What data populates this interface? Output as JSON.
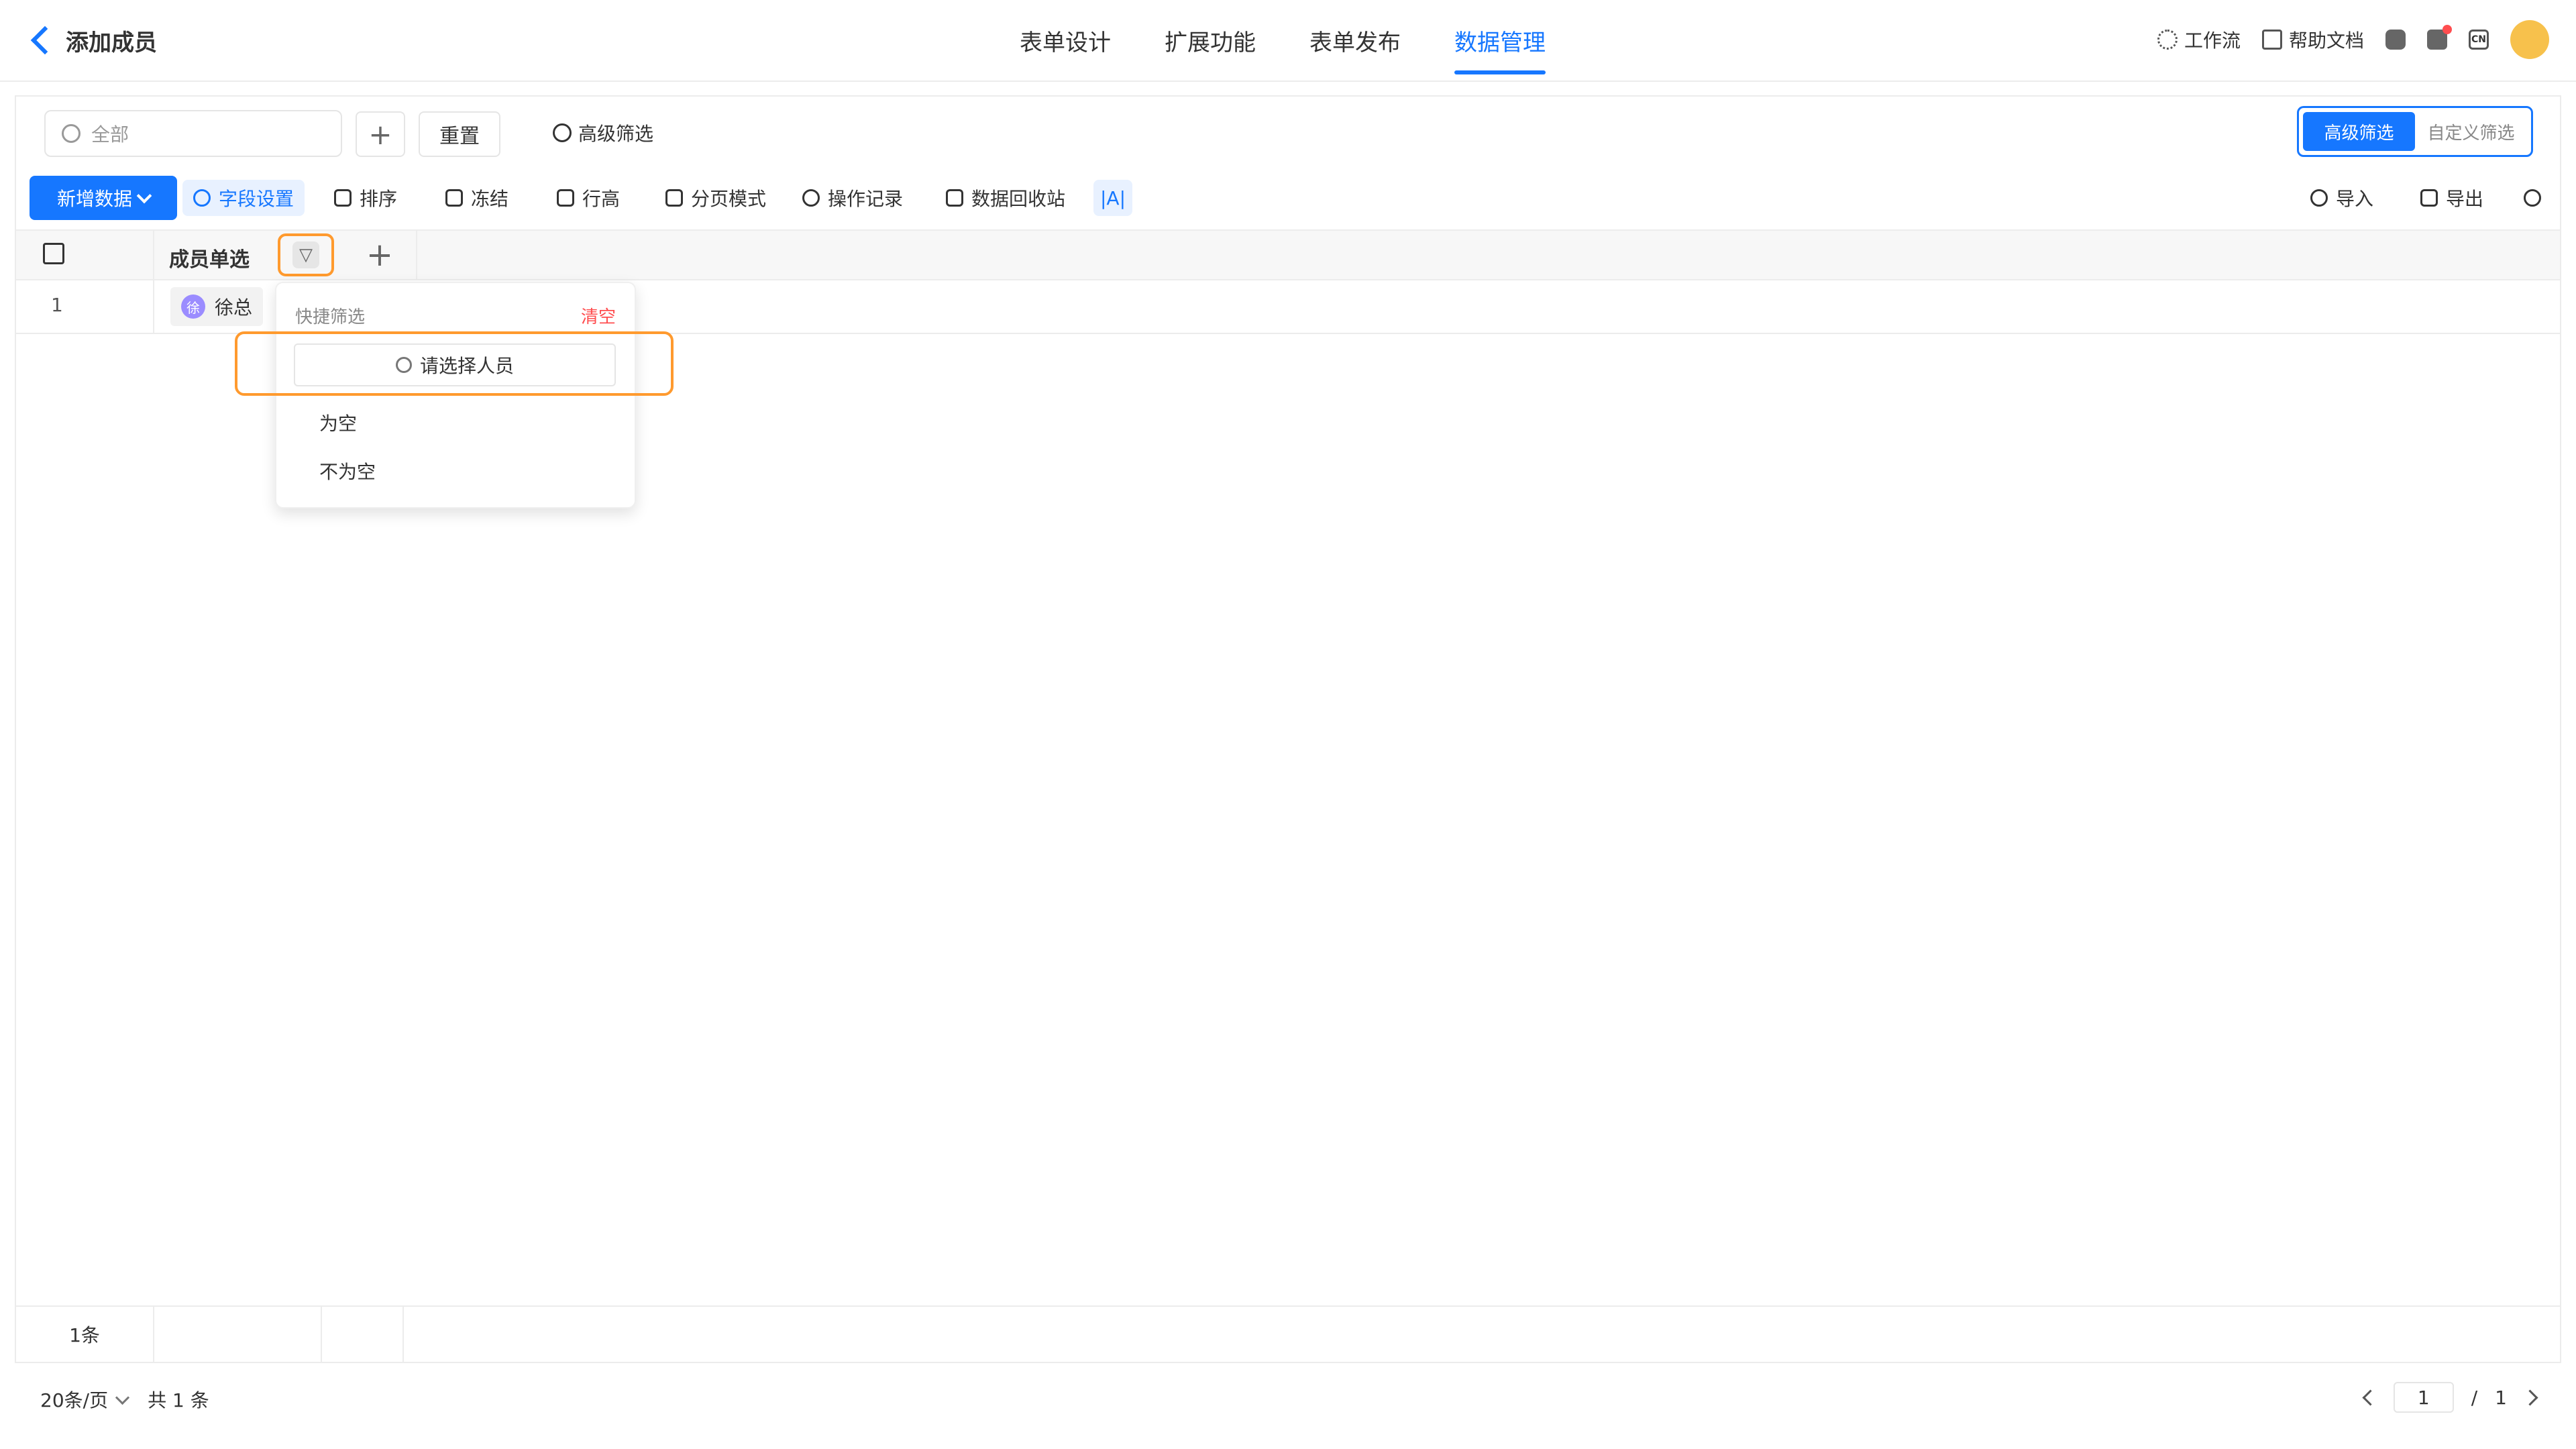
{
  "header": {
    "back_label": "添加成员",
    "tabs": [
      {
        "label": "表单设计",
        "active": false
      },
      {
        "label": "扩展功能",
        "active": false
      },
      {
        "label": "表单发布",
        "active": false
      },
      {
        "label": "数据管理",
        "active": true
      }
    ],
    "tools": {
      "workflow": "工作流",
      "help_docs": "帮助文档",
      "lang": "CN"
    }
  },
  "filterbar": {
    "search_placeholder": "全部",
    "reset_label": "重置",
    "advanced_label": "高级筛选",
    "segment": {
      "advanced": "高级筛选",
      "custom": "自定义筛选"
    }
  },
  "toolbar": {
    "new_data": "新增数据",
    "field_settings": "字段设置",
    "sort": "排序",
    "freeze": "冻结",
    "row_height": "行高",
    "paging_mode": "分页模式",
    "operation_log": "操作记录",
    "recycle_bin": "数据回收站",
    "text_mode": "|A|",
    "import": "导入",
    "export": "导出"
  },
  "table": {
    "column_title": "成员单选",
    "rows": [
      {
        "index": "1",
        "member_avatar": "徐",
        "member_name": "徐总"
      }
    ]
  },
  "filter_popup": {
    "header": "快捷筛选",
    "clear": "清空",
    "picker_placeholder": "请选择人员",
    "options": [
      "为空",
      "不为空"
    ]
  },
  "summary": {
    "count_label": "1条"
  },
  "pagination": {
    "page_size": "20条/页",
    "total": "共 1 条",
    "current_page": "1",
    "slash": "/",
    "total_pages": "1"
  },
  "colors": {
    "primary": "#1677ff",
    "highlight": "#ff9a2e",
    "danger": "#ff4d4f",
    "avatar_yellow": "#f7c14c",
    "member_avatar": "#9b8cff"
  }
}
